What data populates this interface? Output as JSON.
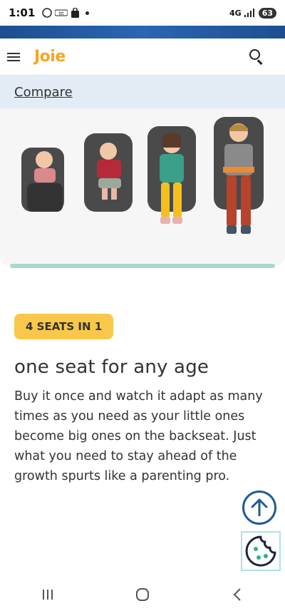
{
  "status_bar": {
    "time": "1:01",
    "network": "4G",
    "battery": "63"
  },
  "header": {
    "logo_text": "Joie",
    "menu_icon": "hamburger-icon",
    "search_icon": "search-icon"
  },
  "compare": {
    "label": "Compare"
  },
  "product": {
    "badge": "4 SEATS IN 1",
    "headline": "one seat for any age",
    "description": "Buy it once and watch it adapt as many times as you need as your little ones become big ones on the backseat. Just what you need to stay ahead of the growth spurts like a parenting pro."
  },
  "floating": {
    "scroll_top_icon": "arrow-up-icon",
    "cookie_icon": "cookie-icon"
  },
  "nav": {
    "recent_icon": "recent-apps-icon",
    "home_icon": "home-icon",
    "back_icon": "back-icon"
  },
  "colors": {
    "brand_orange": "#f5a623",
    "blue_bar": "#2a66b3",
    "compare_bg": "#e3ecf5",
    "badge_yellow": "#f9c84a",
    "teal_line": "#a8d8cf"
  }
}
